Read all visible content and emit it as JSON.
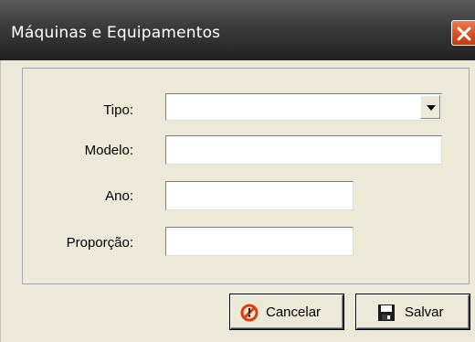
{
  "window": {
    "title": "Máquinas e Equipamentos"
  },
  "form": {
    "tipo": {
      "label": "Tipo:",
      "value": ""
    },
    "modelo": {
      "label": "Modelo:",
      "value": ""
    },
    "ano": {
      "label": "Ano:",
      "value": ""
    },
    "proporcao": {
      "label": "Proporção:",
      "value": ""
    }
  },
  "buttons": {
    "cancel_label": "Cancelar",
    "save_label": "Salvar"
  },
  "icons": {
    "close": "close-icon",
    "dropdown": "chevron-down-icon",
    "cancel": "cancel-icon",
    "save": "floppy-disk-icon"
  },
  "colors": {
    "titlebar": "#2f2f2f",
    "close_button": "#d94b1f",
    "background": "#ece9d8",
    "cancel_icon": "#e03a10"
  }
}
